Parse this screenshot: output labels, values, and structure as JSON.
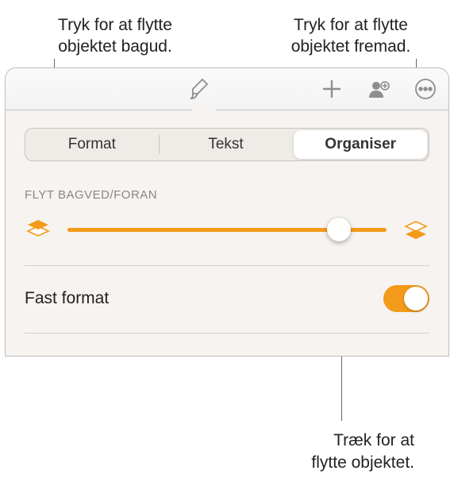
{
  "callouts": {
    "top_left_line1": "Tryk for at flytte",
    "top_left_line2": "objektet bagud.",
    "top_right_line1": "Tryk for at flytte",
    "top_right_line2": "objektet fremad.",
    "bottom_line1": "Træk for at",
    "bottom_line2": "flytte objektet."
  },
  "tabs": {
    "format": "Format",
    "text": "Tekst",
    "organise": "Organiser"
  },
  "section_label": "FLYT BAGVED/FORAN",
  "slider": {
    "position_pct": 85
  },
  "toggle": {
    "label": "Fast format",
    "on": true
  },
  "colors": {
    "accent": "#f39a1a"
  }
}
